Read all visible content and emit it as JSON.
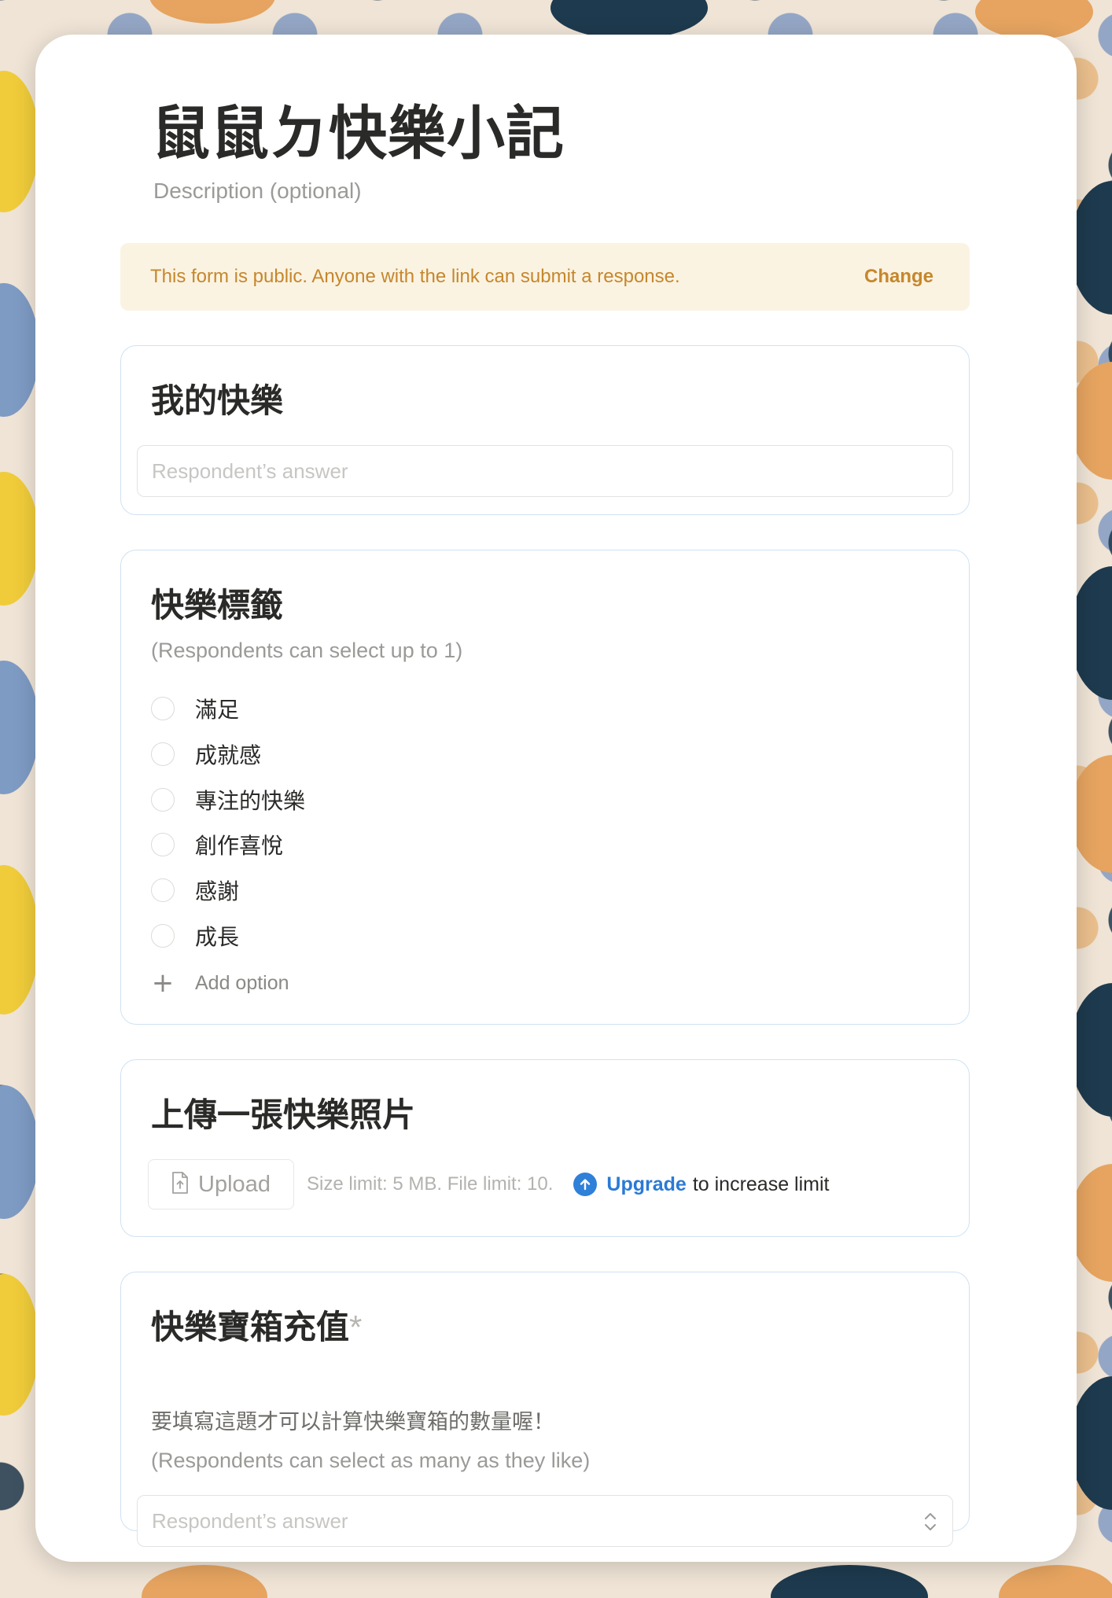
{
  "form": {
    "title": "鼠鼠ㄉ快樂小記",
    "description_placeholder": "Description (optional)"
  },
  "notice": {
    "text": "This form is public. Anyone with the link can submit a response.",
    "action_label": "Change"
  },
  "questions": [
    {
      "title": "我的快樂",
      "answer_placeholder": "Respondent’s answer"
    },
    {
      "title": "快樂標籤",
      "hint": "(Respondents can select up to 1)",
      "options": [
        "滿足",
        "成就感",
        "專注的快樂",
        "創作喜悅",
        "感謝",
        "成長"
      ],
      "add_option_label": "Add option"
    },
    {
      "title": "上傳一張快樂照片",
      "upload_label": "Upload",
      "size_limit_text": "Size limit: 5 MB. File limit: 10.",
      "upgrade_link": "Upgrade",
      "upgrade_rest": "to increase limit"
    },
    {
      "title": "快樂寶箱充值",
      "required_mark": "*",
      "description": "要填寫這題才可以計算快樂寶箱的數量喔！",
      "hint": "(Respondents can select as many as they like)",
      "answer_placeholder": "Respondent’s answer"
    }
  ],
  "colors": {
    "notice_bg": "#fbf3e2",
    "notice_text": "#c5872c",
    "link_blue": "#2a7ad6",
    "card_border": "#cfe2f2"
  },
  "icons": [
    "file-upload-icon",
    "arrow-up-circle-icon",
    "plus-icon",
    "chevron-up-down-icon"
  ]
}
